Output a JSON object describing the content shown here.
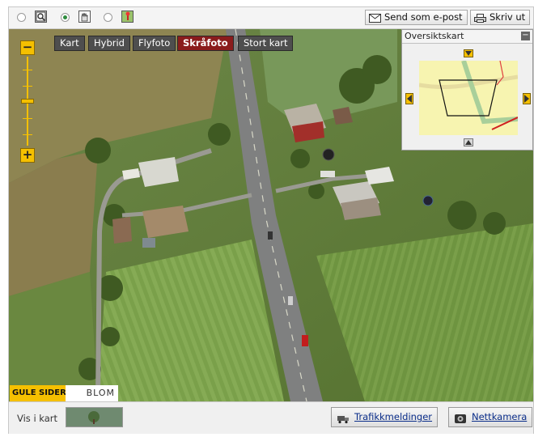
{
  "toolbar": {
    "tools": [
      {
        "name": "zoom-tool",
        "selected": false
      },
      {
        "name": "pan-tool",
        "selected": true
      },
      {
        "name": "marker-tool",
        "selected": false
      }
    ],
    "send_email_label": "Send som e-post",
    "print_label": "Skriv ut"
  },
  "map": {
    "types": [
      {
        "label": "Kart",
        "active": false
      },
      {
        "label": "Hybrid",
        "active": false
      },
      {
        "label": "Flyfoto",
        "active": false
      },
      {
        "label": "Skråfoto",
        "active": true
      },
      {
        "label": "Stort kart",
        "active": false
      }
    ],
    "zoom": {
      "minus": "−",
      "plus": "+",
      "level_fraction": 0.5
    }
  },
  "overview": {
    "title": "Oversiktskart",
    "collapse_label": "−"
  },
  "logos": {
    "gule_sider": "GULE SIDER",
    "blom": "BLOM"
  },
  "bottom": {
    "vis_i_kart_label": "Vis i kart",
    "traffic_label": "Trafikkmeldinger",
    "webcam_label": "Nettkamera"
  },
  "colors": {
    "accent_yellow": "#f5c000",
    "active_type": "#8a1c1c",
    "link_blue": "#0b2e8a"
  }
}
